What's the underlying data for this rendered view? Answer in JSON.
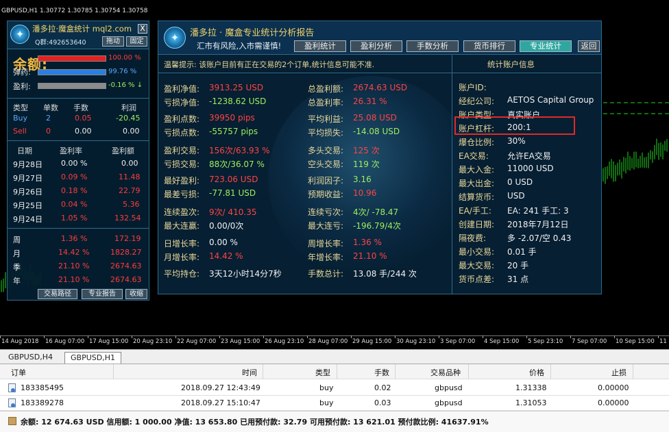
{
  "chart": {
    "title": "GBPUSD,H1  1.30772 1.30785 1.30754 1.30758",
    "x_labels": [
      "14 Aug 2018",
      "16 Aug 07:00",
      "17 Aug 15:00",
      "20 Aug 23:10",
      "22 Aug 07:00",
      "23 Aug 15:00",
      "26 Aug 23:10",
      "28 Aug 07:00",
      "29 Aug 15:00",
      "30 Aug 23:10",
      "3 Sep 07:00",
      "4 Sep 15:00",
      "5 Sep 23:10",
      "7 Sep 07:00",
      "10 Sep 15:00",
      "11 S"
    ]
  },
  "left_panel": {
    "title": "潘多拉·魔盒统计 mql2.com",
    "qq": "Q群:492653640",
    "drag_button": "拖动",
    "fix_button": "固定",
    "close_button": "X",
    "balance_label": "余额:",
    "ammo_label": "弹药:",
    "profit_label": "盈利:",
    "bars": [
      {
        "label": "余额:",
        "pct": "100.00 %",
        "fill": 1.0,
        "color": "#e52020"
      },
      {
        "label": "弹药:",
        "pct": "99.76 %",
        "fill": 0.9976,
        "color": "#2a7fe0"
      },
      {
        "label": "盈利:",
        "pct": "-0.16 % ↓",
        "fill": 1.0,
        "color": "#8c8c8c"
      }
    ],
    "positions_header": [
      "类型",
      "单数",
      "手数",
      "利润"
    ],
    "positions": [
      {
        "type": "Buy",
        "count": "2",
        "lots": "0.05",
        "profit": "-20.45"
      },
      {
        "type": "Sell",
        "count": "0",
        "lots": "0.00",
        "profit": "0.00"
      }
    ],
    "daily_header": [
      "日期",
      "盈利率",
      "盈利额"
    ],
    "daily": [
      {
        "date": "9月28日",
        "rate": "0.00 %",
        "amount": "0.00"
      },
      {
        "date": "9月27日",
        "rate": "0.09 %",
        "amount": "11.48"
      },
      {
        "date": "9月26日",
        "rate": "0.18 %",
        "amount": "22.79"
      },
      {
        "date": "9月25日",
        "rate": "0.04 %",
        "amount": "5.36"
      },
      {
        "date": "9月24日",
        "rate": "1.05 %",
        "amount": "132.54"
      }
    ],
    "period": [
      {
        "label": "周",
        "rate": "1.36 %",
        "amount": "172.19"
      },
      {
        "label": "月",
        "rate": "14.42 %",
        "amount": "1828.27"
      },
      {
        "label": "季",
        "rate": "21.10 %",
        "amount": "2674.63"
      },
      {
        "label": "年",
        "rate": "21.10 %",
        "amount": "2674.63"
      }
    ],
    "footer_buttons": [
      "交易路径",
      "专业报告",
      "收缩"
    ]
  },
  "main_panel": {
    "title": "潘多拉 · 魔盒专业统计分析报告",
    "warning": "汇市有风险,入市需谨慎!",
    "tabs": [
      "盈利统计",
      "盈利分析",
      "手数分析",
      "货币排行",
      "专业统计",
      "返回"
    ],
    "active_tab": 4,
    "notice": "温馨提示:  该账户目前有正在交易的2个订单,统计信息可能不准.",
    "account_header": "统计账户信息",
    "stats_left": [
      {
        "label": "盈利净值:",
        "value": "3913.25 USD",
        "color": "red"
      },
      {
        "label": "亏损净值:",
        "value": "-1238.62 USD",
        "color": "green"
      },
      {
        "label": "盈利点数:",
        "value": "39950 pips",
        "color": "red"
      },
      {
        "label": "亏损点数:",
        "value": "-55757 pips",
        "color": "green"
      },
      {
        "label": "盈利交易:",
        "value": "156次/63.93 %",
        "color": "red"
      },
      {
        "label": "亏损交易:",
        "value": "88次/36.07 %",
        "color": "green"
      },
      {
        "label": "最好盈利:",
        "value": "723.06 USD",
        "color": "red"
      },
      {
        "label": "最差亏损:",
        "value": "-77.81 USD",
        "color": "green"
      },
      {
        "label": "连续盈次:",
        "value": "9次/ 410.35",
        "color": "red"
      },
      {
        "label": "最大连赢:",
        "value": "0.00/0次",
        "color": "white"
      },
      {
        "label": "日增长率:",
        "value": "0.00 %",
        "color": "white"
      },
      {
        "label": "月增长率:",
        "value": "14.42 %",
        "color": "red"
      },
      {
        "label": "平均持仓:",
        "value": "3天12小时14分7秒",
        "color": "white"
      }
    ],
    "stats_right": [
      {
        "label": "总盈利额:",
        "value": "2674.63 USD",
        "color": "red"
      },
      {
        "label": "总盈利率:",
        "value": "26.31 %",
        "color": "red"
      },
      {
        "label": "平均利益:",
        "value": "25.08 USD",
        "color": "red"
      },
      {
        "label": "平均损失:",
        "value": "-14.08 USD",
        "color": "green"
      },
      {
        "label": "多头交易:",
        "value": "125 次",
        "color": "red"
      },
      {
        "label": "空头交易:",
        "value": "119 次",
        "color": "green"
      },
      {
        "label": "利润因子:",
        "value": "3.16",
        "color": "green"
      },
      {
        "label": "预期收益:",
        "value": "10.96",
        "color": "red"
      },
      {
        "label": "连续亏次:",
        "value": "4次/ -78.47",
        "color": "green"
      },
      {
        "label": "最大连亏:",
        "value": "-196.79/4次",
        "color": "green"
      },
      {
        "label": "周增长率:",
        "value": "1.36 %",
        "color": "red"
      },
      {
        "label": "年增长率:",
        "value": "21.10 %",
        "color": "red"
      },
      {
        "label": "手数总计:",
        "value": "13.08 手/244 次",
        "color": "white"
      }
    ],
    "account": [
      {
        "label": "账户ID:",
        "value": ""
      },
      {
        "label": "经纪公司:",
        "value": "AETOS Capital Group"
      },
      {
        "label": "账户类型:",
        "value": "真实账户"
      },
      {
        "label": "账户杠杆:",
        "value": "200:1"
      },
      {
        "label": "爆仓比例:",
        "value": "30%"
      },
      {
        "label": "EA交易:",
        "value": "允许EA交易"
      },
      {
        "label": "最大入金:",
        "value": "11000 USD"
      },
      {
        "label": "最大出金:",
        "value": "0 USD"
      },
      {
        "label": "结算货币:",
        "value": "USD"
      },
      {
        "label": "EA/手工:",
        "value": "EA: 241 手工: 3"
      },
      {
        "label": "创建日期:",
        "value": "2018年7月12日"
      },
      {
        "label": "隔夜费:",
        "value": "多 -2.07/空 0.43"
      },
      {
        "label": "最小交易:",
        "value": "0.01 手"
      },
      {
        "label": "最大交易:",
        "value": "20 手"
      },
      {
        "label": "货币点差:",
        "value": "31 点"
      }
    ]
  },
  "bottom": {
    "chart_tabs": [
      "GBPUSD,H4",
      "GBPUSD,H1"
    ],
    "active_chart_tab": 1,
    "columns": [
      "订单",
      "时间",
      "类型",
      "手数",
      "交易品种",
      "价格",
      "止损"
    ],
    "rows": [
      {
        "order": "183385495",
        "time": "2018.09.27 12:43:49",
        "type": "buy",
        "lots": "0.02",
        "symbol": "gbpusd",
        "price": "1.31338",
        "sl": "0.00000"
      },
      {
        "order": "183389278",
        "time": "2018.09.27 15:10:47",
        "type": "buy",
        "lots": "0.03",
        "symbol": "gbpusd",
        "price": "1.31053",
        "sl": "0.00000"
      }
    ],
    "summary": "余额: 12 674.63 USD  信用额: 1 000.00  净值: 13 653.80  已用预付款: 32.79  可用预付款: 13 621.01  预付款比例: 41637.91%"
  }
}
